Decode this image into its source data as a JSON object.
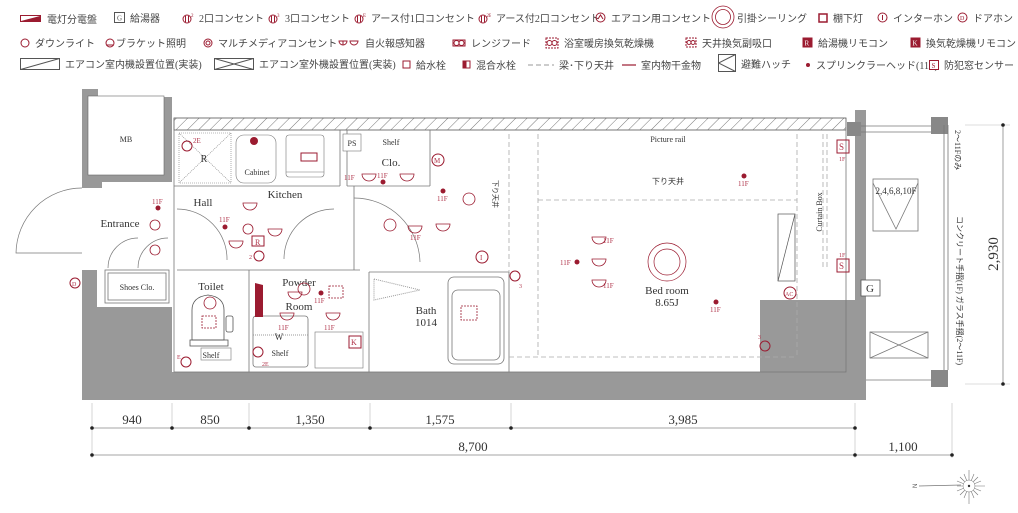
{
  "legend": {
    "row1": [
      {
        "icon": "distribution-board-icon",
        "label": "電灯分電盤"
      },
      {
        "icon": "water-heater-icon",
        "label": "給湯器"
      },
      {
        "icon": "outlet-2-icon",
        "label": "2口コンセント"
      },
      {
        "icon": "outlet-3-icon",
        "label": "3口コンセント"
      },
      {
        "icon": "outlet-earth-1-icon",
        "label": "アース付1口コンセント"
      },
      {
        "icon": "outlet-earth-2-icon",
        "label": "アース付2口コンセント"
      },
      {
        "icon": "ac-outlet-icon",
        "label": "エアコン用コンセント"
      },
      {
        "icon": "ceiling-hook-icon",
        "label": "引掛シーリング"
      },
      {
        "icon": "under-shelf-light-icon",
        "label": "棚下灯"
      },
      {
        "icon": "intercom-icon",
        "label": "インターホン"
      },
      {
        "icon": "door-phone-icon",
        "label": "ドアホン"
      }
    ],
    "row2": [
      {
        "icon": "downlight-icon",
        "label": "ダウンライト"
      },
      {
        "icon": "bracket-light-icon",
        "label": "ブラケット照明"
      },
      {
        "icon": "multimedia-outlet-icon",
        "label": "マルチメディアコンセント"
      },
      {
        "icon": "fire-alarm-icon",
        "label": "自火報感知器"
      },
      {
        "icon": "range-hood-icon",
        "label": "レンジフード"
      },
      {
        "icon": "bath-dryer-icon",
        "label": "浴室暖房換気乾燥機"
      },
      {
        "icon": "ceiling-vent-icon",
        "label": "天井換気副吸口"
      },
      {
        "icon": "water-heater-remote-icon",
        "label": "給湯機リモコン"
      },
      {
        "icon": "dryer-remote-icon",
        "label": "換気乾燥機リモコン"
      }
    ],
    "row3": [
      {
        "icon": "ac-indoor-unit-icon",
        "label": "エアコン室内機設置位置(実装)"
      },
      {
        "icon": "ac-outdoor-unit-icon",
        "label": "エアコン室外機設置位置(実装)"
      },
      {
        "icon": "water-faucet-icon",
        "label": "給水栓"
      },
      {
        "icon": "mixing-faucet-icon",
        "label": "混合水栓"
      },
      {
        "icon": "beam-line-icon",
        "label": "梁･下り天井"
      },
      {
        "icon": "laundry-pole-icon",
        "label": "室内物干金物"
      },
      {
        "icon": "escape-hatch-icon",
        "label": "避難ハッチ"
      },
      {
        "icon": "sprinkler-icon",
        "label": "スプリンクラーヘッド(11F)"
      },
      {
        "icon": "window-sensor-icon",
        "label": "防犯窓センサー"
      }
    ]
  },
  "rooms": {
    "mb": "MB",
    "entrance": "Entrance",
    "shoes": "Shoes Clo.",
    "hall": "Hall",
    "kitchen": "Kitchen",
    "cabinet": "Cabinet",
    "refrigerator": "R",
    "ps": "PS",
    "shelf": "Shelf",
    "clo": "Clo.",
    "toilet": "Toilet",
    "powder1": "Powder",
    "powder2": "Room",
    "washer": "W",
    "bath": "Bath",
    "bath_size": "1014",
    "picture_rail": "Picture rail",
    "lowered_ceiling": "下り天井",
    "bedroom": "Bed room",
    "bedroom_size": "8.65J",
    "curtain_box": "Curtain Box",
    "balcony_floors": "2,4,6,8,10F",
    "water_heater": "G",
    "note_2_11": "2〜11Fのみ",
    "railing_note": "コンクリート手摺(1F) ガラス手摺(2〜11F)"
  },
  "marks": {
    "sprinkler": "11F",
    "f1": "1F",
    "e2": "2E",
    "e": "E",
    "two": "2",
    "three": "3",
    "d": "D",
    "m": "M",
    "i": "I",
    "k": "K",
    "s": "S",
    "ac": "AC"
  },
  "dimensions": {
    "segments": [
      "940",
      "850",
      "1,350",
      "1,575",
      "3,985"
    ],
    "total": "8,700",
    "balcony": "1,100",
    "depth": "2,930"
  },
  "compass": {
    "north_label": "N"
  }
}
